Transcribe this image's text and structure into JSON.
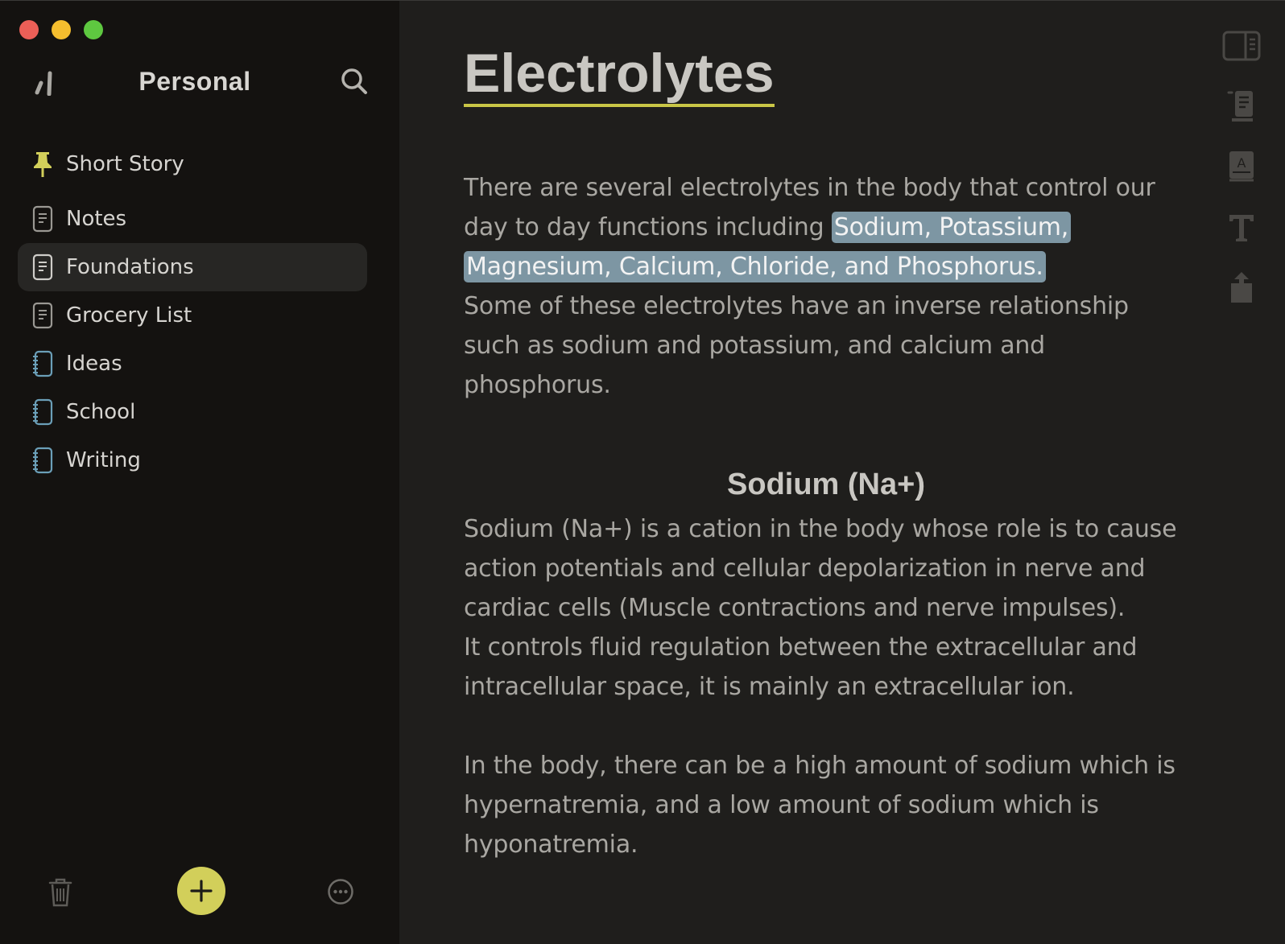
{
  "window": {
    "traffic_colors": [
      "#ec5f57",
      "#f5be2e",
      "#5ec840"
    ]
  },
  "sidebar": {
    "title": "Personal",
    "items": [
      {
        "label": "Short Story",
        "icon": "pin-icon",
        "pinned": true
      },
      {
        "label": "Notes",
        "icon": "document-icon"
      },
      {
        "label": "Foundations",
        "icon": "document-icon",
        "selected": true
      },
      {
        "label": "Grocery List",
        "icon": "document-icon"
      },
      {
        "label": "Ideas",
        "icon": "notebook-icon"
      },
      {
        "label": "School",
        "icon": "notebook-icon"
      },
      {
        "label": "Writing",
        "icon": "notebook-icon"
      }
    ],
    "footer": {
      "trash_icon": "trash-icon",
      "add_icon": "plus-icon",
      "more_icon": "ellipsis-circle-icon"
    },
    "accent": "#d2cf5a"
  },
  "document": {
    "title": "Electrolytes",
    "intro_before": "There are several electrolytes in the body that control our day to day functions including ",
    "intro_highlight_1": "Sodium, Potassium,",
    "intro_highlight_2": "Magnesium, Calcium, Chloride, and Phosphorus.",
    "intro_after": "Some of these electrolytes have an inverse relationship such as sodium and potassium, and calcium and phosphorus.",
    "heading": "Sodium (Na+)",
    "sodium_p1": "Sodium (Na+) is a cation in the body whose role is to cause action potentials and cellular depolarization in nerve and cardiac cells (Muscle contractions and nerve impulses).",
    "sodium_p2": "It controls fluid regulation between the extracellular and intracellular space, it is mainly an extracellular ion.",
    "sodium_p3": "In the body, there can be a high amount of sodium which is hypernatremia, and a low amount of sodium which is hyponatremia.",
    "highlight_color": "#7d96a3"
  },
  "toolbar": {
    "icons": [
      "sidebar-toggle-icon",
      "outline-icon",
      "dictionary-icon",
      "typography-icon",
      "share-icon"
    ]
  }
}
